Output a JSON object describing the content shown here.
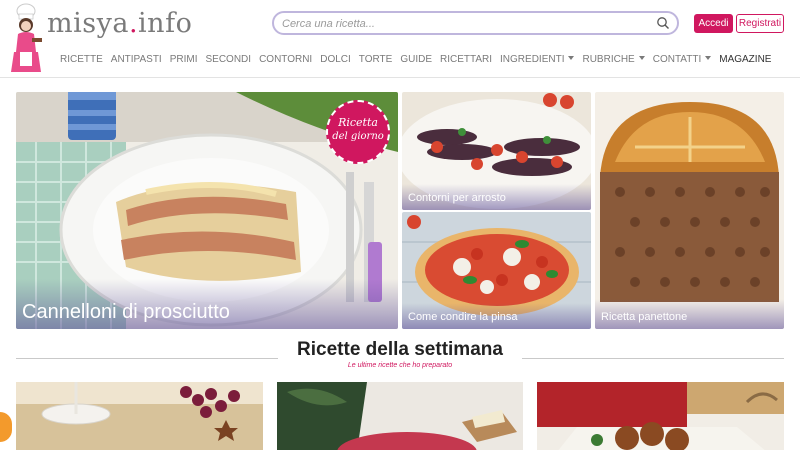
{
  "header": {
    "logo": {
      "name": "misya",
      "dot": ".",
      "suffix": "info"
    },
    "search": {
      "placeholder": "Cerca una ricetta..."
    },
    "login_label": "Accedi",
    "register_label": "Registrati"
  },
  "nav": {
    "items": [
      {
        "label": "RICETTE",
        "dropdown": false
      },
      {
        "label": "ANTIPASTI",
        "dropdown": false
      },
      {
        "label": "PRIMI",
        "dropdown": false
      },
      {
        "label": "SECONDI",
        "dropdown": false
      },
      {
        "label": "CONTORNI",
        "dropdown": false
      },
      {
        "label": "DOLCI",
        "dropdown": false
      },
      {
        "label": "TORTE",
        "dropdown": false
      },
      {
        "label": "GUIDE",
        "dropdown": false
      },
      {
        "label": "RICETTARI",
        "dropdown": false
      },
      {
        "label": "INGREDIENTI",
        "dropdown": true
      },
      {
        "label": "RUBRICHE",
        "dropdown": true
      },
      {
        "label": "CONTATTI",
        "dropdown": true
      },
      {
        "label": "MAGAZINE",
        "dropdown": false
      }
    ]
  },
  "hero": {
    "main": {
      "title": "Cannelloni di prosciutto",
      "badge_line1": "Ricetta",
      "badge_line2": "del giorno"
    },
    "top_middle": {
      "title": "Contorni per arrosto"
    },
    "bottom_middle": {
      "title": "Come condire la pinsa"
    },
    "right": {
      "title": "Ricetta panettone"
    }
  },
  "section": {
    "title": "Ricette della settimana",
    "subtitle": "Le ultime ricette che ho preparato"
  },
  "colors": {
    "brand": "#d0175f",
    "search_border": "#bfb6dd",
    "nav_text": "#7a7a7a"
  }
}
